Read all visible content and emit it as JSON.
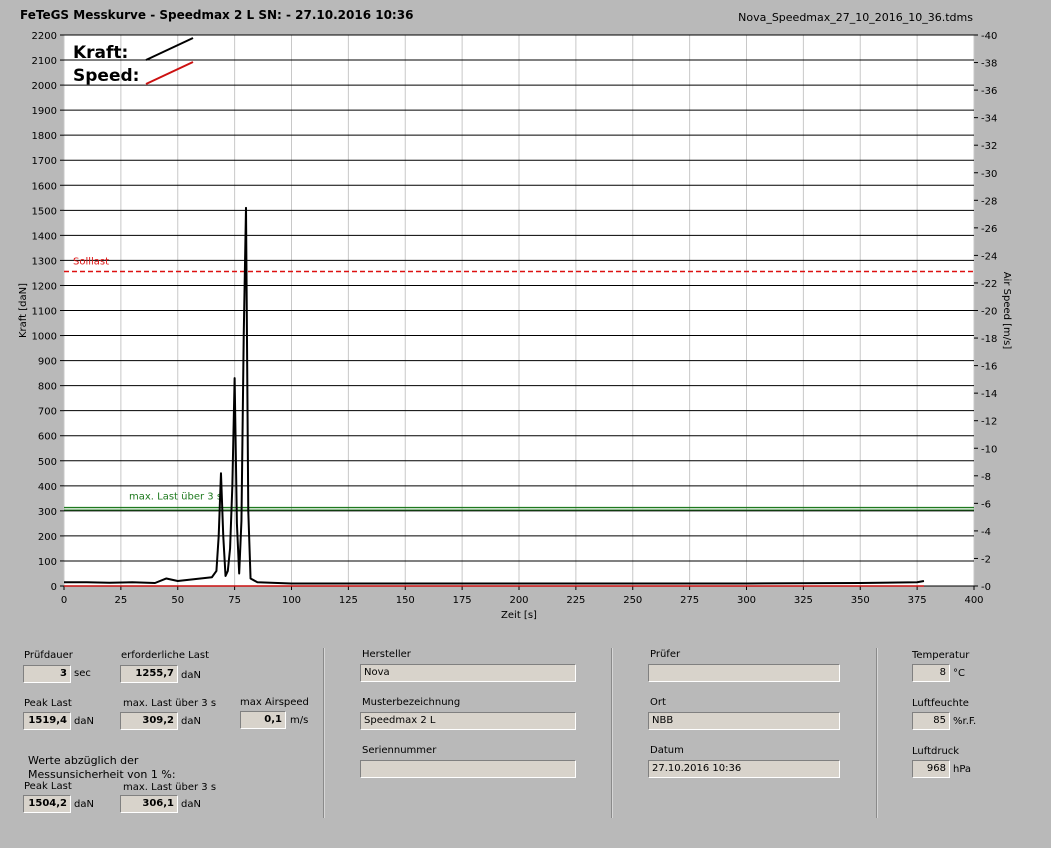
{
  "header": {
    "title": "FeTeGS Messkurve - Speedmax 2 L  SN:  - 27.10.2016 10:36",
    "filename": "Nova_Speedmax_27_10_2016_10_36.tdms"
  },
  "chart_data": {
    "type": "line",
    "xlabel": "Zeit [s]",
    "ylabel": "Kraft [daN]",
    "y2label": "Air Speed [m/s]",
    "xlim": [
      0,
      400
    ],
    "ylim": [
      0,
      2200
    ],
    "y2lim": [
      0,
      40
    ],
    "xticks": [
      0,
      25,
      50,
      75,
      100,
      125,
      150,
      175,
      200,
      225,
      250,
      275,
      300,
      325,
      350,
      375,
      400
    ],
    "yticks": [
      0,
      100,
      200,
      300,
      400,
      500,
      600,
      700,
      800,
      900,
      1000,
      1100,
      1200,
      1300,
      1400,
      1500,
      1600,
      1700,
      1800,
      1900,
      2000,
      2100,
      2200
    ],
    "y2ticks": [
      0,
      2,
      4,
      6,
      8,
      10,
      12,
      14,
      16,
      18,
      20,
      22,
      24,
      26,
      28,
      30,
      32,
      34,
      36,
      38,
      40
    ],
    "grid": true,
    "legend": [
      {
        "name": "Kraft:",
        "color": "#000000"
      },
      {
        "name": "Speed:",
        "color": "#cc1111"
      }
    ],
    "series": [
      {
        "name": "Kraft",
        "color": "#000000",
        "x": [
          0,
          10,
          20,
          30,
          40,
          45,
          50,
          55,
          60,
          65,
          67,
          68,
          69,
          70,
          71,
          72,
          73,
          74,
          75,
          76,
          77,
          78,
          79,
          80,
          81,
          82,
          85,
          100,
          150,
          200,
          250,
          300,
          350,
          375,
          378
        ],
        "y": [
          15,
          15,
          13,
          15,
          12,
          30,
          20,
          25,
          30,
          35,
          60,
          200,
          450,
          200,
          40,
          60,
          150,
          400,
          830,
          250,
          50,
          260,
          1000,
          1510,
          300,
          30,
          15,
          10,
          10,
          10,
          10,
          10,
          12,
          15,
          20
        ]
      },
      {
        "name": "Speed",
        "color": "#cc1111",
        "x": [
          0,
          378
        ],
        "y": [
          0,
          0
        ]
      }
    ],
    "reference_lines": [
      {
        "name": "Solllast",
        "value": 1255.7,
        "color": "#dd1111",
        "style": "dashed"
      },
      {
        "name": "max. Last über  3 s",
        "value": 309.2,
        "color": "#1f7a1f",
        "style": "solid"
      }
    ]
  },
  "panel": {
    "pruefdauer": {
      "label": "Prüfdauer",
      "value": "3",
      "unit": "sec"
    },
    "erforderliche_last": {
      "label": "erforderliche Last",
      "value": "1255,7",
      "unit": "daN"
    },
    "peak_last": {
      "label": "Peak Last",
      "value": "1519,4",
      "unit": "daN"
    },
    "max_last": {
      "label": "max. Last über  3 s",
      "value": "309,2",
      "unit": "daN"
    },
    "max_airspeed": {
      "label": "max Airspeed",
      "value": "0,1",
      "unit": "m/s"
    },
    "werte_note_1": "Werte abzüglich der",
    "werte_note_2": "Messunsicherheit von 1  %:",
    "peak_last_corr": {
      "label": "Peak Last",
      "value": "1504,2",
      "unit": "daN"
    },
    "max_last_corr": {
      "label": "max. Last über  3 s",
      "value": "306,1",
      "unit": "daN"
    },
    "hersteller": {
      "label": "Hersteller",
      "value": "Nova"
    },
    "musterbezeichnung": {
      "label": "Musterbezeichnung",
      "value": "Speedmax 2 L"
    },
    "seriennummer": {
      "label": "Seriennummer",
      "value": ""
    },
    "pruefer": {
      "label": "Prüfer",
      "value": ""
    },
    "ort": {
      "label": "Ort",
      "value": "NBB"
    },
    "datum": {
      "label": "Datum",
      "value": "27.10.2016 10:36"
    },
    "temperatur": {
      "label": "Temperatur",
      "value": "8",
      "unit": "°C"
    },
    "luftfeuchte": {
      "label": "Luftfeuchte",
      "value": "85",
      "unit": "%r.F."
    },
    "luftdruck": {
      "label": "Luftdruck",
      "value": "968",
      "unit": "hPa"
    }
  }
}
